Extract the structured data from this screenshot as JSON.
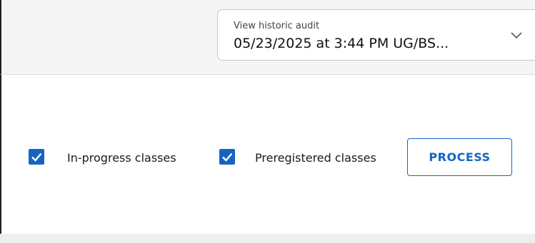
{
  "audit_selector": {
    "label": "View historic audit",
    "value": "05/23/2025 at 3:44 PM UG/BS...",
    "icon": "chevron-down-icon"
  },
  "options": {
    "in_progress": {
      "label": "In-progress classes",
      "checked": true
    },
    "preregistered": {
      "label": "Preregistered classes",
      "checked": true
    }
  },
  "process_button": {
    "label": "PROCESS"
  },
  "colors": {
    "accent": "#1565c0",
    "background": "#f5f5f5",
    "panel": "#ffffff"
  }
}
